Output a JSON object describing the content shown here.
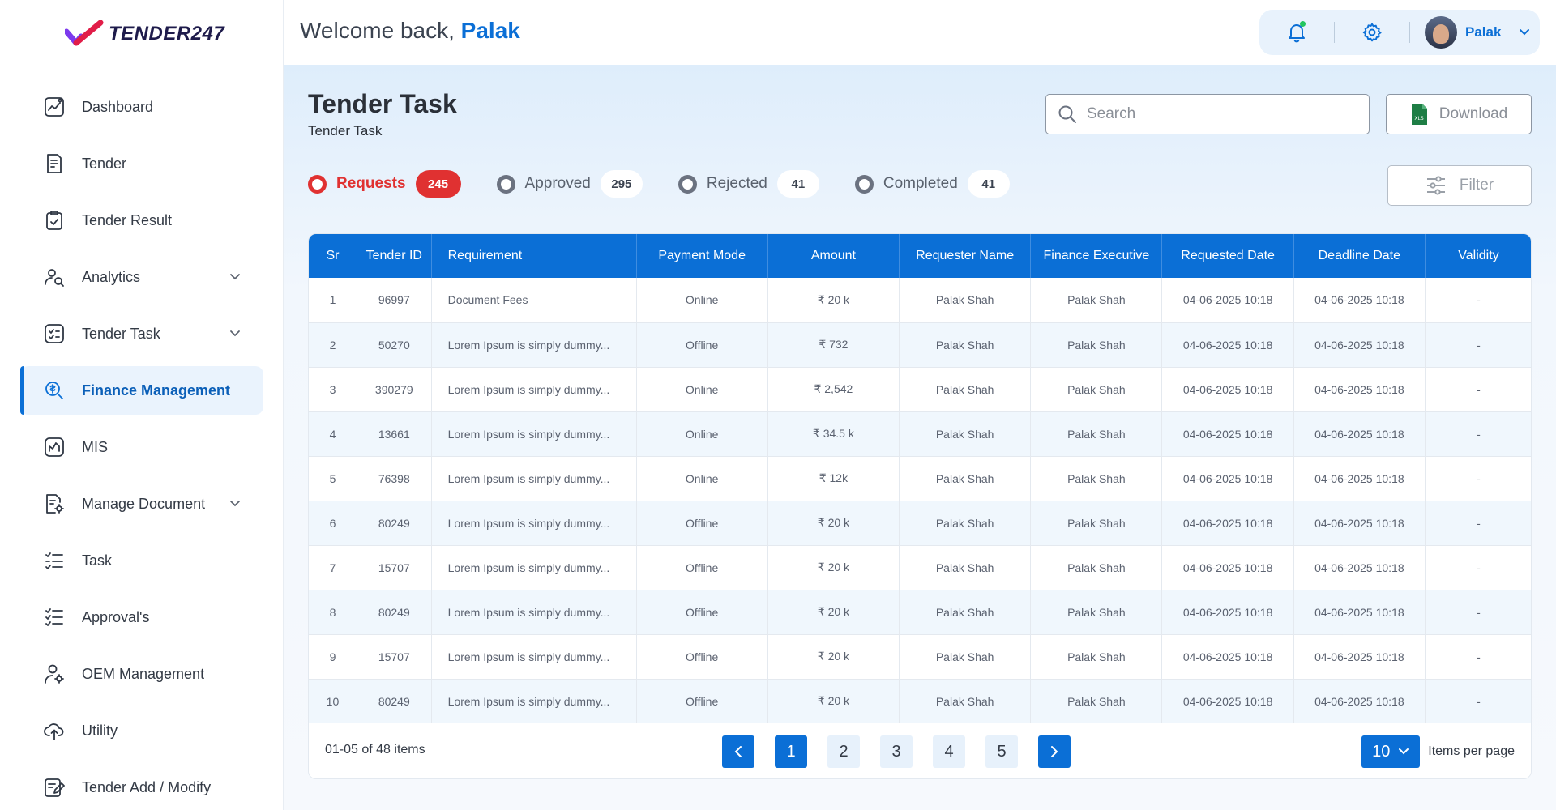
{
  "brand": {
    "logo_text": "TENDER247"
  },
  "sidebar": {
    "items": [
      {
        "label": "Dashboard",
        "icon": "chart-line-icon",
        "chevron": false,
        "active": false
      },
      {
        "label": "Tender",
        "icon": "document-edit-icon",
        "chevron": false,
        "active": false
      },
      {
        "label": "Tender Result",
        "icon": "clipboard-check-icon",
        "chevron": false,
        "active": false
      },
      {
        "label": "Analytics",
        "icon": "user-search-icon",
        "chevron": true,
        "active": false
      },
      {
        "label": "Tender Task",
        "icon": "task-list-icon",
        "chevron": true,
        "active": false
      },
      {
        "label": "Finance Management",
        "icon": "finance-search-icon",
        "chevron": false,
        "active": true
      },
      {
        "label": "MIS",
        "icon": "report-chart-icon",
        "chevron": false,
        "active": false
      },
      {
        "label": "Manage Document",
        "icon": "document-settings-icon",
        "chevron": true,
        "active": false
      },
      {
        "label": "Task",
        "icon": "checklist-icon",
        "chevron": false,
        "active": false
      },
      {
        "label": "Approval's",
        "icon": "approval-list-icon",
        "chevron": false,
        "active": false
      },
      {
        "label": "OEM Management",
        "icon": "user-gear-icon",
        "chevron": false,
        "active": false
      },
      {
        "label": "Utility",
        "icon": "cloud-upload-icon",
        "chevron": false,
        "active": false
      },
      {
        "label": "Tender Add / Modify",
        "icon": "edit-document-icon",
        "chevron": false,
        "active": false
      }
    ]
  },
  "header": {
    "welcome_prefix": "Welcome back,",
    "welcome_name": "Palak",
    "user_name": "Palak"
  },
  "page": {
    "title": "Tender Task",
    "subtitle": "Tender Task",
    "search_placeholder": "Search",
    "download_label": "Download",
    "filter_label": "Filter"
  },
  "tabs": [
    {
      "label": "Requests",
      "count": "245",
      "active": true
    },
    {
      "label": "Approved",
      "count": "295",
      "active": false
    },
    {
      "label": "Rejected",
      "count": "41",
      "active": false
    },
    {
      "label": "Completed",
      "count": "41",
      "active": false
    }
  ],
  "table": {
    "columns": [
      "Sr",
      "Tender ID",
      "Requirement",
      "Payment Mode",
      "Amount",
      "Requester Name",
      "Finance Executive",
      "Requested Date",
      "Deadline Date",
      "Validity"
    ],
    "rows": [
      [
        "1",
        "96997",
        "Document Fees",
        "Online",
        "₹ 20 k",
        "Palak Shah",
        "Palak Shah",
        "04-06-2025 10:18",
        "04-06-2025 10:18",
        "-"
      ],
      [
        "2",
        "50270",
        "Lorem Ipsum is simply dummy...",
        "Offline",
        "₹ 732",
        "Palak Shah",
        "Palak Shah",
        "04-06-2025 10:18",
        "04-06-2025 10:18",
        "-"
      ],
      [
        "3",
        "390279",
        "Lorem Ipsum is simply dummy...",
        "Online",
        "₹ 2,542",
        "Palak Shah",
        "Palak Shah",
        "04-06-2025 10:18",
        "04-06-2025 10:18",
        "-"
      ],
      [
        "4",
        "13661",
        "Lorem Ipsum is simply dummy...",
        "Online",
        "₹ 34.5 k",
        "Palak Shah",
        "Palak Shah",
        "04-06-2025 10:18",
        "04-06-2025 10:18",
        "-"
      ],
      [
        "5",
        "76398",
        "Lorem Ipsum is simply dummy...",
        "Online",
        "₹ 12k",
        "Palak Shah",
        "Palak Shah",
        "04-06-2025 10:18",
        "04-06-2025 10:18",
        "-"
      ],
      [
        "6",
        "80249",
        "Lorem Ipsum is simply dummy...",
        "Offline",
        "₹ 20 k",
        "Palak Shah",
        "Palak Shah",
        "04-06-2025 10:18",
        "04-06-2025 10:18",
        "-"
      ],
      [
        "7",
        "15707",
        "Lorem Ipsum is simply dummy...",
        "Offline",
        "₹ 20 k",
        "Palak Shah",
        "Palak Shah",
        "04-06-2025 10:18",
        "04-06-2025 10:18",
        "-"
      ],
      [
        "8",
        "80249",
        "Lorem Ipsum is simply dummy...",
        "Offline",
        "₹ 20 k",
        "Palak Shah",
        "Palak Shah",
        "04-06-2025 10:18",
        "04-06-2025 10:18",
        "-"
      ],
      [
        "9",
        "15707",
        "Lorem Ipsum is simply dummy...",
        "Offline",
        "₹ 20 k",
        "Palak Shah",
        "Palak Shah",
        "04-06-2025 10:18",
        "04-06-2025 10:18",
        "-"
      ],
      [
        "10",
        "80249",
        "Lorem Ipsum is simply dummy...",
        "Offline",
        "₹ 20 k",
        "Palak Shah",
        "Palak Shah",
        "04-06-2025 10:18",
        "04-06-2025 10:18",
        "-"
      ]
    ]
  },
  "pagination": {
    "items_info": "01-05 of 48 items",
    "pages": [
      "1",
      "2",
      "3",
      "4",
      "5"
    ],
    "current_page": "1",
    "per_page_value": "10",
    "per_page_label": "Items per page"
  },
  "colors": {
    "primary": "#0b6fd6",
    "accent_red": "#e03131",
    "notification_dot": "#22c55e"
  }
}
